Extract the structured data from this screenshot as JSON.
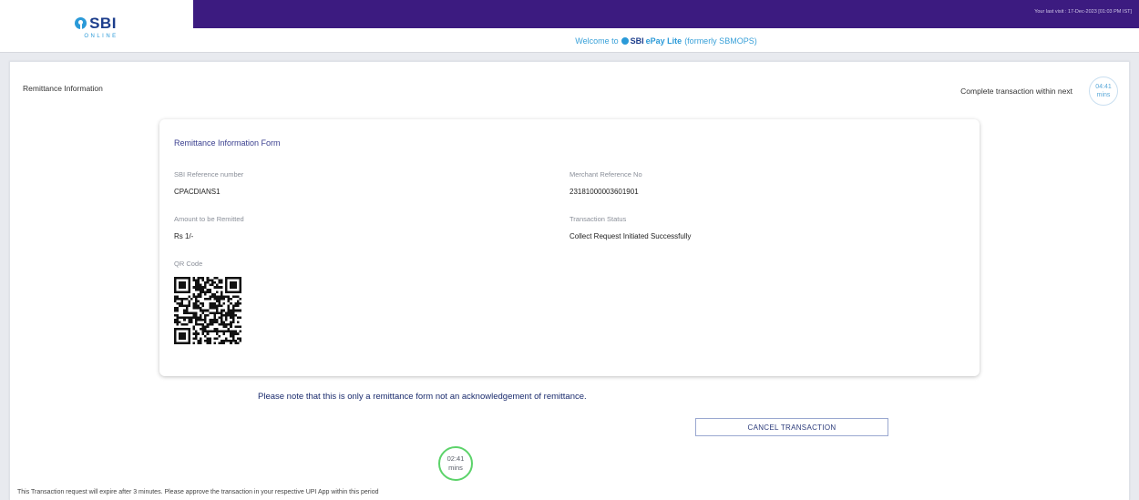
{
  "header": {
    "logo_text": "SBI",
    "logo_subtext": "ONLINE",
    "last_visit": "Your last visit : 17-Dec-2023 [01:03 PM IST]",
    "welcome_prefix": "Welcome to",
    "welcome_brand": "SBI",
    "welcome_product": "ePay Lite",
    "welcome_suffix": "(formerly SBMOPS)"
  },
  "panel": {
    "title": "Remittance Information",
    "timer_label": "Complete transaction within next",
    "timer_value": "04:41",
    "timer_unit": "mins"
  },
  "form": {
    "title": "Remittance Information Form",
    "sbi_ref_label": "SBI Reference number",
    "sbi_ref_value": "CPACDIANS1",
    "merchant_ref_label": "Merchant Reference No",
    "merchant_ref_value": "23181000003601901",
    "amount_label": "Amount to be Remitted",
    "amount_value": "Rs 1/-",
    "status_label": "Transaction Status",
    "status_value": "Collect Request Initiated Successfully",
    "qr_label": "QR Code"
  },
  "footer": {
    "note": "Please note that this is only a remittance form not an acknowledgement of remittance.",
    "cancel_label": "CANCEL TRANSACTION",
    "countdown_value": "02:41",
    "countdown_unit": "mins",
    "expiry_text": "This Transaction request will expire after 3 minutes. Please approve the transaction in your respective UPI App within this period"
  },
  "colors": {
    "topbar": "#3c1b80",
    "brand_blue": "#1d3e8c",
    "accent_blue": "#2b9ad8",
    "countdown_ring": "#5cd36a"
  }
}
